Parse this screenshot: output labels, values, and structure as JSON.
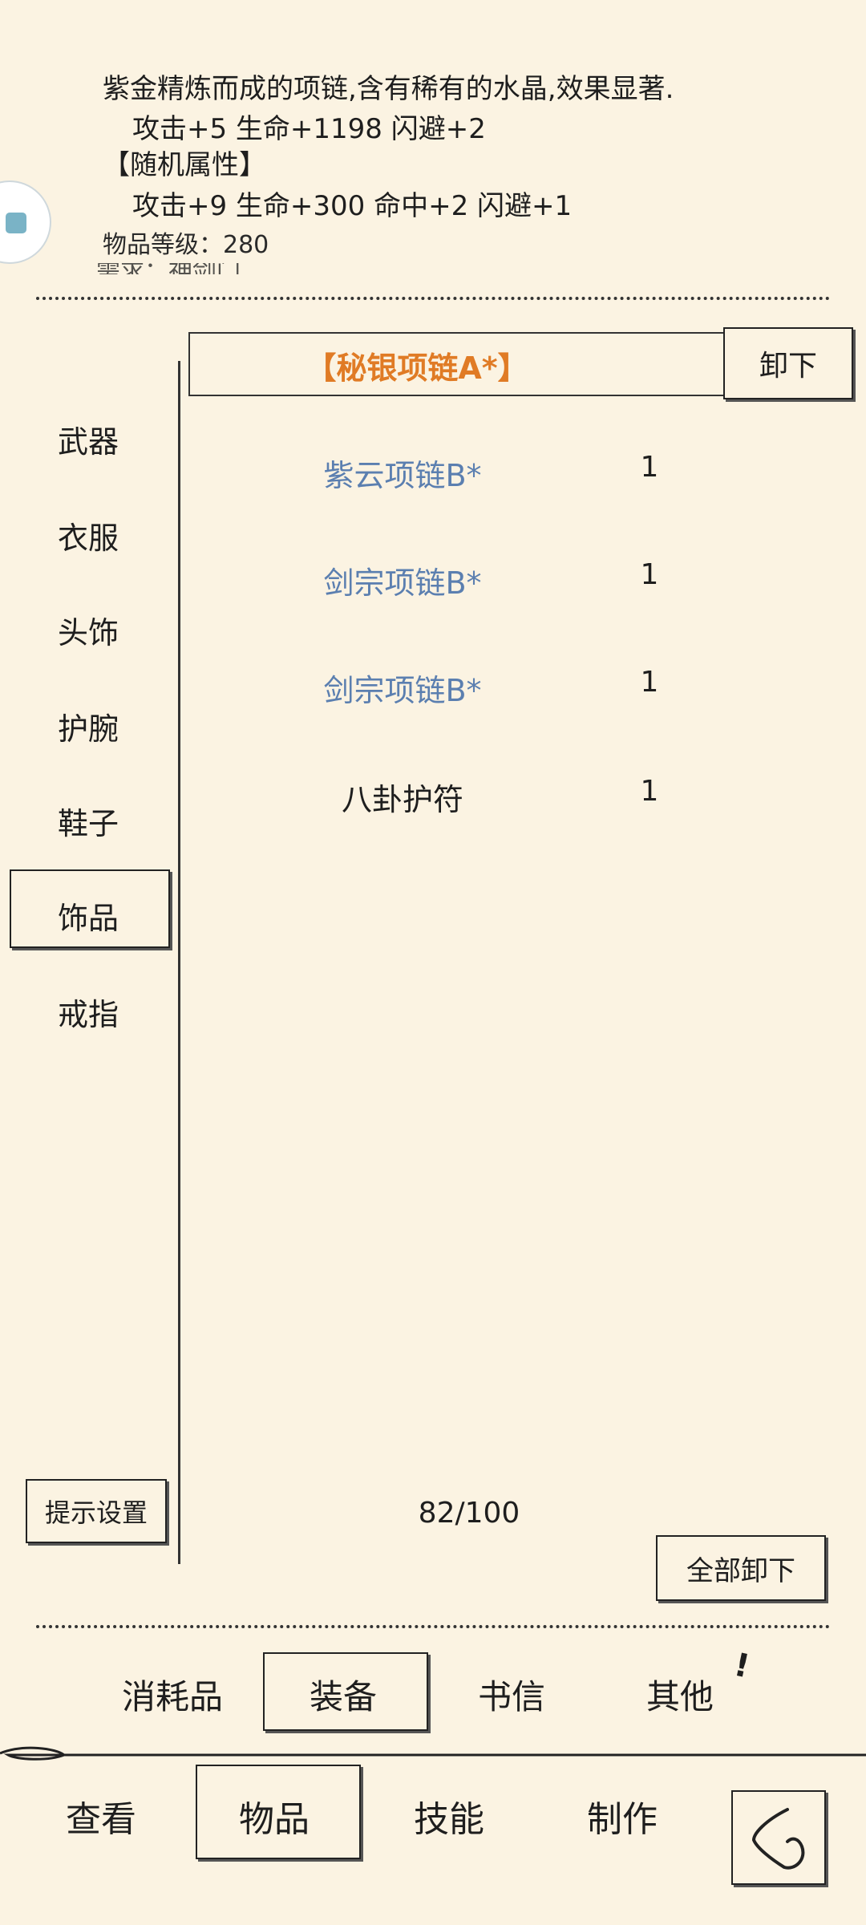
{
  "detail": {
    "description": "紫金精炼而成的项链,含有稀有的水晶,效果显著.",
    "base_stats": "攻击+5 生命+1198 闪避+2",
    "random_header": "【随机属性】",
    "random_stats": "攻击+9 生命+300 命中+2 闪避+1",
    "item_level": "物品等级：280",
    "partial_line": "需求：神剑门"
  },
  "equipped": {
    "name": "【秘银项链A*】",
    "unequip_label": "卸下",
    "name_color": "#e07b25"
  },
  "categories": [
    "武器",
    "衣服",
    "头饰",
    "护腕",
    "鞋子",
    "饰品",
    "戒指"
  ],
  "selected_category": "饰品",
  "items": [
    {
      "name": "紫云项链B*",
      "qty": "1",
      "color": "#5b7fb0"
    },
    {
      "name": "剑宗项链B*",
      "qty": "1",
      "color": "#5b7fb0"
    },
    {
      "name": "剑宗项链B*",
      "qty": "1",
      "color": "#5b7fb0"
    },
    {
      "name": "八卦护符",
      "qty": "1",
      "color": "#1e1e1e"
    }
  ],
  "hint_settings_label": "提示设置",
  "capacity": "82/100",
  "unequip_all_label": "全部卸下",
  "sub_tabs": [
    "消耗品",
    "装备",
    "书信",
    "其他"
  ],
  "selected_sub_tab": "装备",
  "sub_tab_badge": "!",
  "bottom_nav": [
    "查看",
    "物品",
    "技能",
    "制作"
  ],
  "selected_nav": "物品",
  "floating_icon": "app-launcher-icon"
}
